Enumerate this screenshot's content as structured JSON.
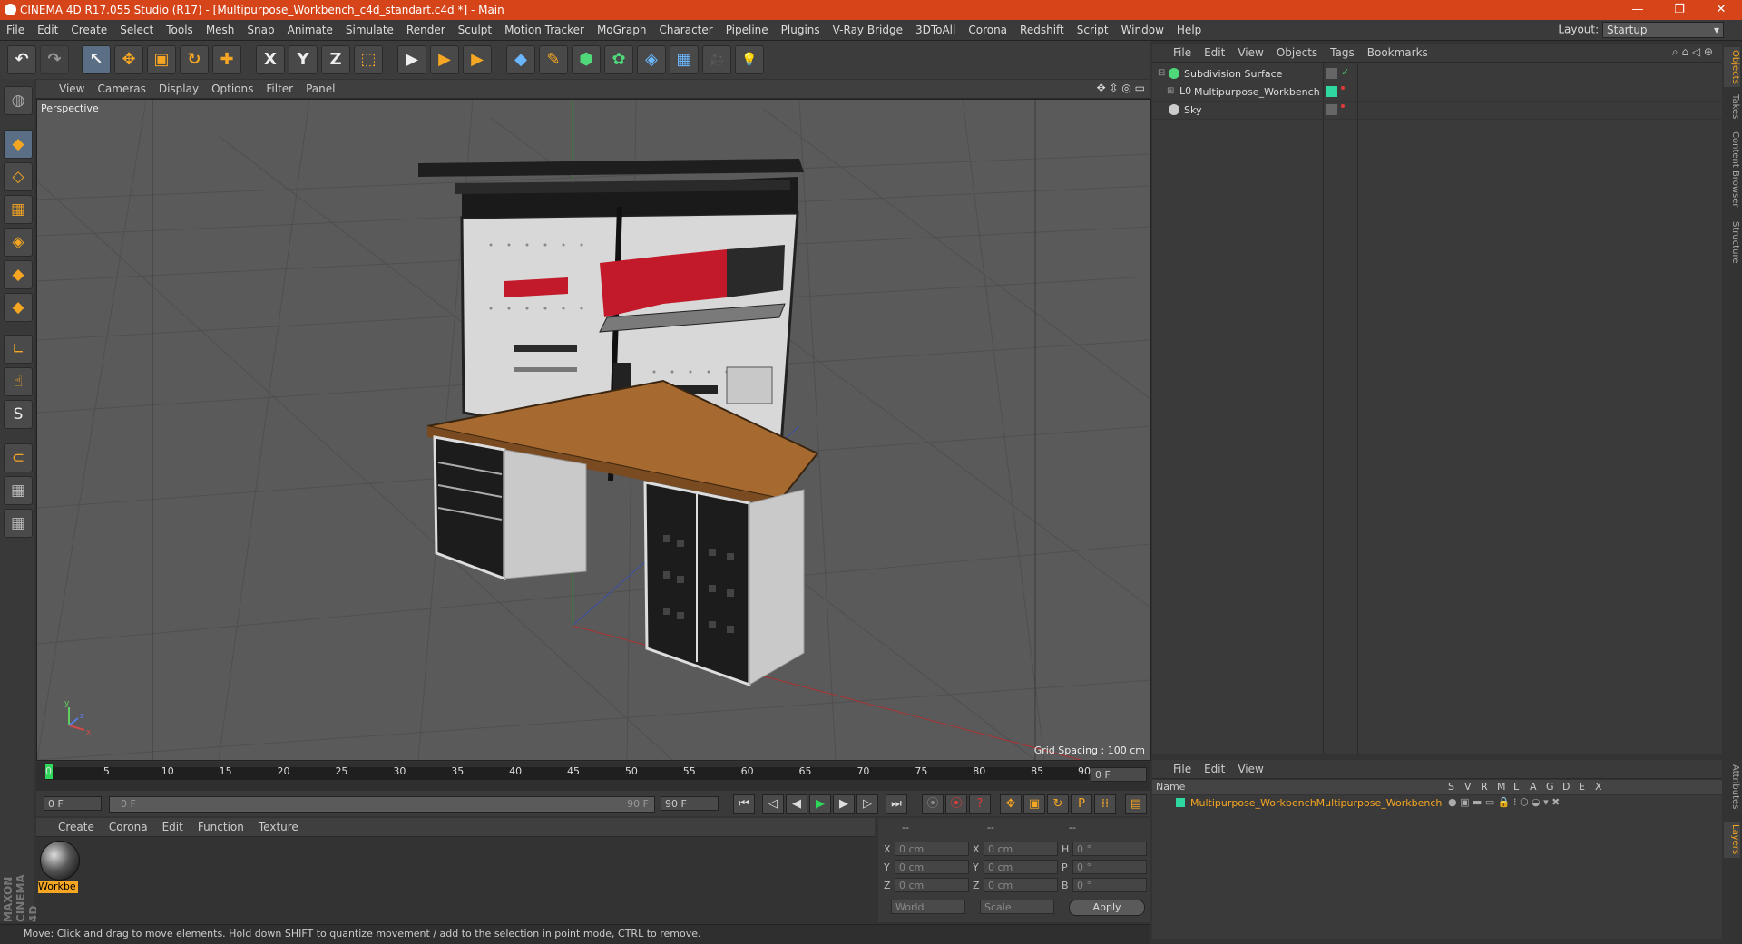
{
  "window": {
    "title": "CINEMA 4D R17.055 Studio (R17) - [Multipurpose_Workbench_c4d_standart.c4d *] - Main",
    "minimize": "—",
    "restore": "❐",
    "close": "✕"
  },
  "menu": [
    "File",
    "Edit",
    "Create",
    "Select",
    "Tools",
    "Mesh",
    "Snap",
    "Animate",
    "Simulate",
    "Render",
    "Sculpt",
    "Motion Tracker",
    "MoGraph",
    "Character",
    "Pipeline",
    "Plugins",
    "V-Ray Bridge",
    "3DToAll",
    "Corona",
    "Redshift",
    "Script",
    "Window",
    "Help"
  ],
  "layout": {
    "label": "Layout:",
    "value": "Startup"
  },
  "toolbar": {
    "undo": "↶",
    "redo": "↷",
    "select": "↖",
    "move": "✥",
    "scale": "▣",
    "rotate": "↻",
    "last": "✚",
    "x": "X",
    "y": "Y",
    "z": "Z",
    "coord": "⬚",
    "render_view": "▶",
    "render_pic": "▶",
    "render_settings": "▶",
    "cube": "◆",
    "pen": "✎",
    "subdiv": "⬢",
    "cloner": "✿",
    "deformer": "◈",
    "floor": "▦",
    "camera": "🎥",
    "light": "💡"
  },
  "leftbar": [
    "◍",
    "◆",
    "◇",
    "▦",
    "◈",
    "◆",
    "◆",
    "∟",
    "☝",
    "S",
    "⊂",
    "▦",
    "▦"
  ],
  "viewport": {
    "menu": [
      "View",
      "Cameras",
      "Display",
      "Options",
      "Filter",
      "Panel"
    ],
    "label": "Perspective",
    "grid_spacing": "Grid Spacing : 100 cm",
    "icons": "✥ ⇳ ◎ ▭"
  },
  "timeline": {
    "ticks": [
      "0",
      "5",
      "10",
      "15",
      "20",
      "25",
      "30",
      "35",
      "40",
      "45",
      "50",
      "55",
      "60",
      "65",
      "70",
      "75",
      "80",
      "85",
      "90"
    ],
    "current_frame": "0 F",
    "start": "0 F",
    "range_start": "0 F",
    "range_end": "90 F",
    "end": "90 F"
  },
  "transport": {
    "first": "⏮",
    "prev_key": "◁",
    "prev": "◀",
    "play": "▶",
    "next": "▶",
    "next_key": "▷",
    "last": "⏭",
    "key1": "⦿",
    "key2": "⦿",
    "key3": "?",
    "m1": "✥",
    "m2": "▣",
    "m3": "↻",
    "m4": "P",
    "m5": "⁞⁞",
    "film": "▤"
  },
  "material_manager": {
    "menu": [
      "Create",
      "Corona",
      "Edit",
      "Function",
      "Texture"
    ],
    "material_name": "Workbe"
  },
  "coordinates": {
    "headers": [
      "--",
      "--",
      "--"
    ],
    "rows": [
      {
        "a": "X",
        "av": "0 cm",
        "b": "X",
        "bv": "0 cm",
        "c": "H",
        "cv": "0 °"
      },
      {
        "a": "Y",
        "av": "0 cm",
        "b": "Y",
        "bv": "0 cm",
        "c": "P",
        "cv": "0 °"
      },
      {
        "a": "Z",
        "av": "0 cm",
        "b": "Z",
        "bv": "0 cm",
        "c": "B",
        "cv": "0 °"
      }
    ],
    "mode1": "World",
    "mode2": "Scale",
    "apply": "Apply"
  },
  "status": "Move: Click and drag to move elements. Hold down SHIFT to quantize movement / add to the selection in point mode, CTRL to remove.",
  "objects": {
    "menu": [
      "File",
      "Edit",
      "View",
      "Objects",
      "Tags",
      "Bookmarks"
    ],
    "items": [
      {
        "name": "Subdivision Surface",
        "color": "#4fd97a"
      },
      {
        "name": "Multipurpose_Workbench",
        "color": "#cccccc"
      },
      {
        "name": "Sky",
        "color": "#8fb4e6"
      }
    ]
  },
  "layers": {
    "menu": [
      "File",
      "Edit",
      "View"
    ],
    "headers": [
      "Name",
      "S",
      "V",
      "R",
      "M",
      "L",
      "A",
      "G",
      "D",
      "E",
      "X"
    ],
    "row": "Multipurpose_WorkbenchMultipurpose_Workbench"
  },
  "vtabs": [
    "Objects",
    "Takes",
    "Content Browser",
    "Structure",
    "Attributes",
    "Layers"
  ],
  "brand": "MAXON CINEMA 4D",
  "axis": {
    "x": "x",
    "y": "y",
    "z": "z"
  }
}
